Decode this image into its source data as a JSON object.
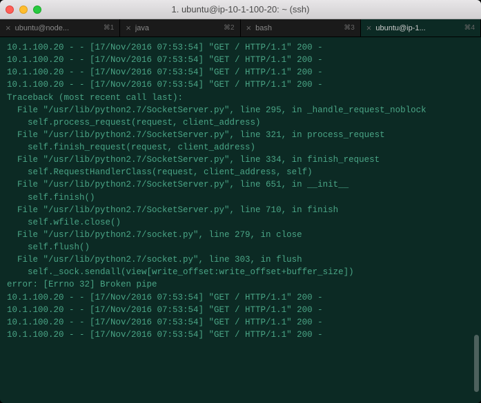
{
  "window": {
    "title": "1. ubuntu@ip-10-1-100-20: ~ (ssh)"
  },
  "tabs": [
    {
      "label": "ubuntu@node...",
      "shortcut": "⌘1",
      "active": false
    },
    {
      "label": "java",
      "shortcut": "⌘2",
      "active": false
    },
    {
      "label": "bash",
      "shortcut": "⌘3",
      "active": false
    },
    {
      "label": "ubuntu@ip-1...",
      "shortcut": "⌘4",
      "active": true
    }
  ],
  "lines": [
    "10.1.100.20 - - [17/Nov/2016 07:53:54] \"GET / HTTP/1.1\" 200 -",
    "10.1.100.20 - - [17/Nov/2016 07:53:54] \"GET / HTTP/1.1\" 200 -",
    "10.1.100.20 - - [17/Nov/2016 07:53:54] \"GET / HTTP/1.1\" 200 -",
    "10.1.100.20 - - [17/Nov/2016 07:53:54] \"GET / HTTP/1.1\" 200 -",
    "Traceback (most recent call last):",
    "  File \"/usr/lib/python2.7/SocketServer.py\", line 295, in _handle_request_noblock",
    "    self.process_request(request, client_address)",
    "  File \"/usr/lib/python2.7/SocketServer.py\", line 321, in process_request",
    "    self.finish_request(request, client_address)",
    "  File \"/usr/lib/python2.7/SocketServer.py\", line 334, in finish_request",
    "    self.RequestHandlerClass(request, client_address, self)",
    "  File \"/usr/lib/python2.7/SocketServer.py\", line 651, in __init__",
    "    self.finish()",
    "  File \"/usr/lib/python2.7/SocketServer.py\", line 710, in finish",
    "    self.wfile.close()",
    "  File \"/usr/lib/python2.7/socket.py\", line 279, in close",
    "    self.flush()",
    "  File \"/usr/lib/python2.7/socket.py\", line 303, in flush",
    "    self._sock.sendall(view[write_offset:write_offset+buffer_size])",
    "error: [Errno 32] Broken pipe",
    "10.1.100.20 - - [17/Nov/2016 07:53:54] \"GET / HTTP/1.1\" 200 -",
    "10.1.100.20 - - [17/Nov/2016 07:53:54] \"GET / HTTP/1.1\" 200 -",
    "10.1.100.20 - - [17/Nov/2016 07:53:54] \"GET / HTTP/1.1\" 200 -",
    "10.1.100.20 - - [17/Nov/2016 07:53:54] \"GET / HTTP/1.1\" 200 -"
  ]
}
